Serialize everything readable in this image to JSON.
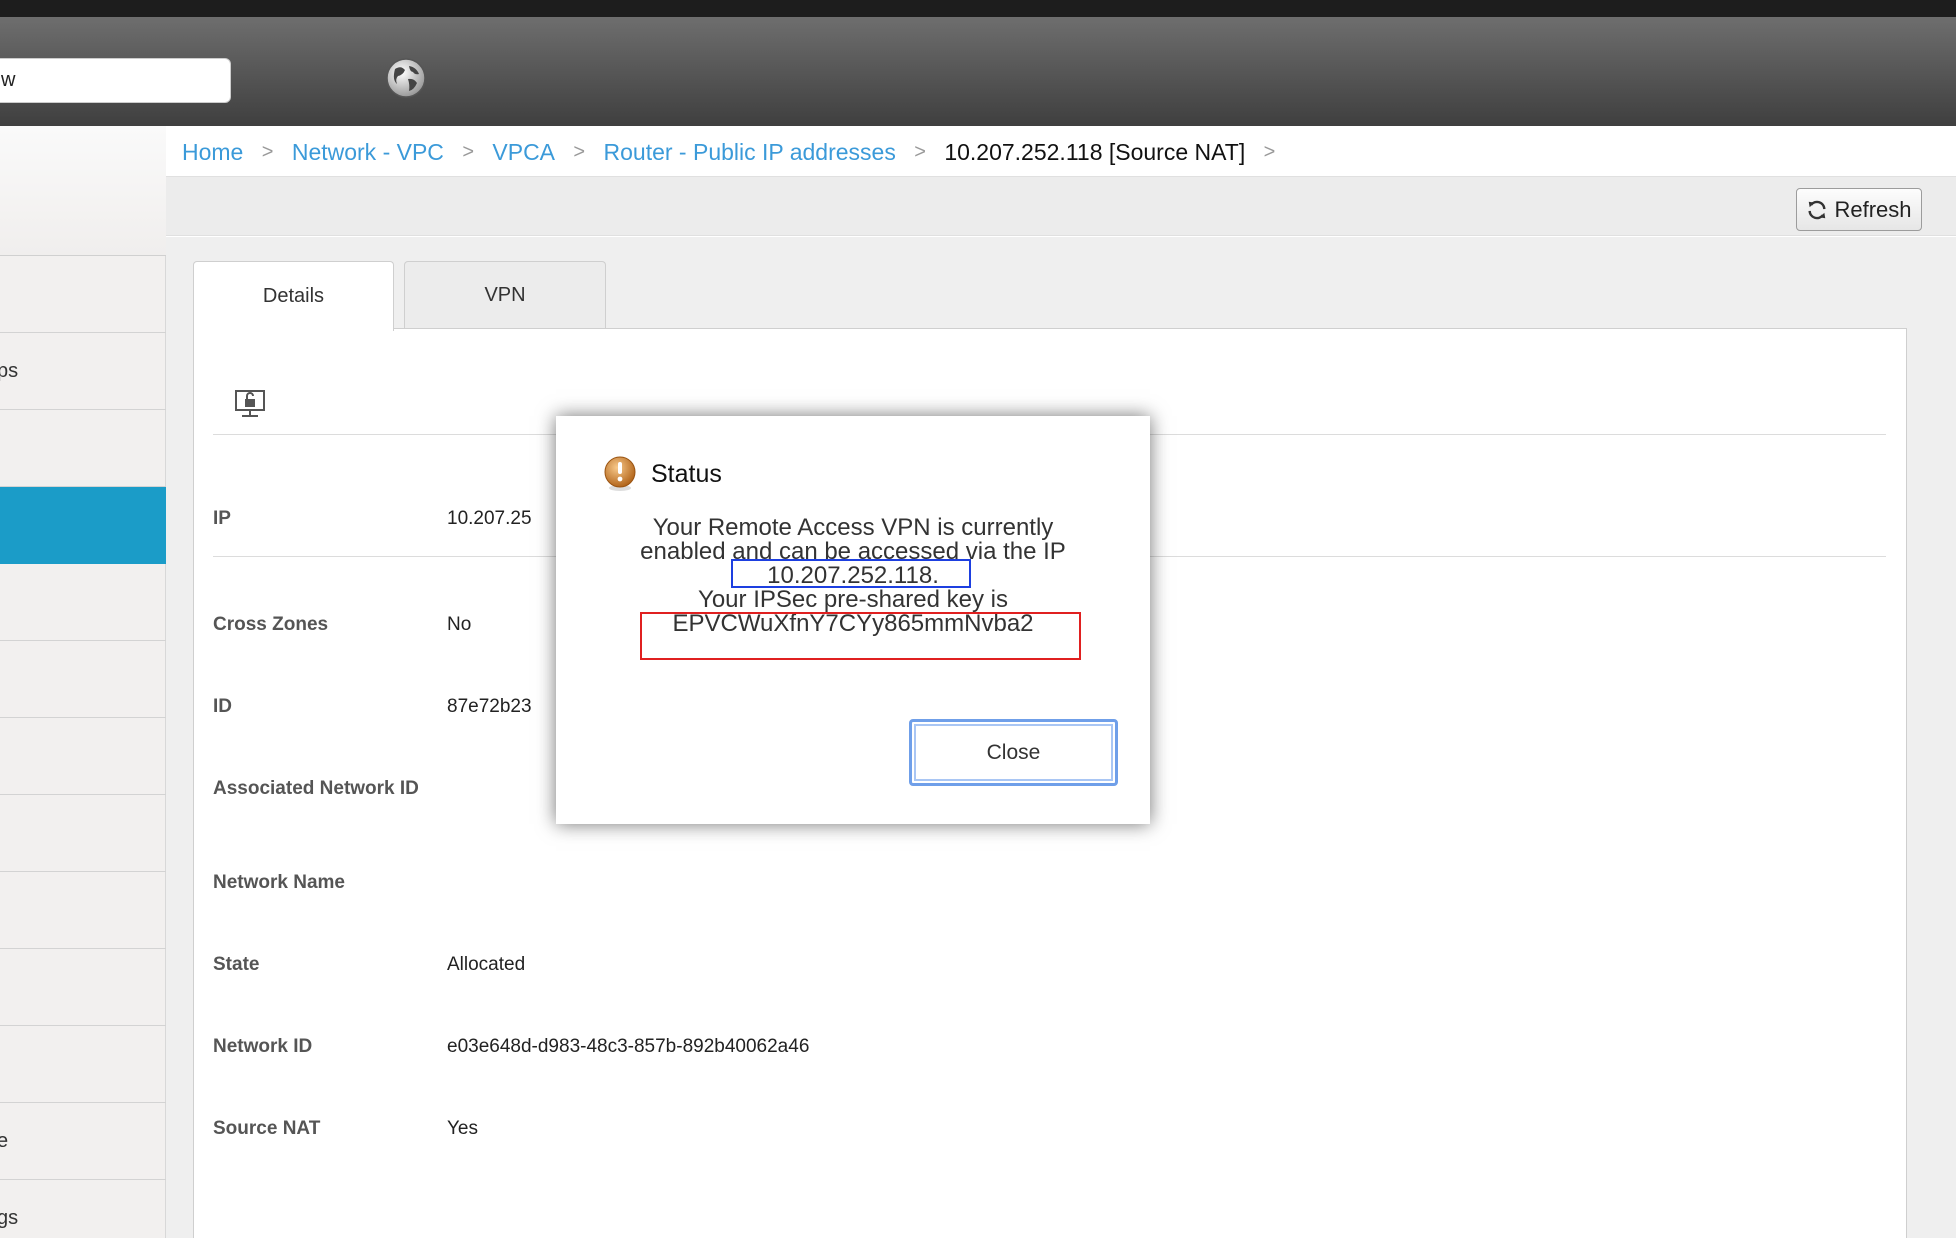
{
  "header": {
    "search_value": "w",
    "globe_icon": "globe-icon"
  },
  "sidebar": {
    "items": [
      {
        "label": ""
      },
      {
        "label": "ps"
      },
      {
        "label": ""
      },
      {
        "label": "",
        "active": true
      },
      {
        "label": ""
      },
      {
        "label": ""
      },
      {
        "label": ""
      },
      {
        "label": ""
      },
      {
        "label": ""
      },
      {
        "label": ""
      },
      {
        "label": ""
      },
      {
        "label": "e"
      },
      {
        "label": "gs"
      }
    ]
  },
  "breadcrumb": {
    "items": [
      "Home",
      "Network - VPC",
      "VPCA",
      "Router - Public IP addresses"
    ],
    "current": "10.207.252.118 [Source NAT]",
    "separator": ">"
  },
  "toolbar": {
    "refresh_label": "Refresh"
  },
  "tabs": {
    "details": "Details",
    "vpn": "VPN"
  },
  "details": {
    "rows": [
      {
        "label": "IP",
        "value": "10.207.25"
      },
      {
        "label": "Cross Zones",
        "value": "No"
      },
      {
        "label": "ID",
        "value": "87e72b23"
      },
      {
        "label": "Associated Network ID",
        "value": ""
      },
      {
        "label": "Network Name",
        "value": ""
      },
      {
        "label": "State",
        "value": "Allocated"
      },
      {
        "label": "Network ID",
        "value": "e03e648d-d983-48c3-857b-892b40062a46"
      },
      {
        "label": "Source NAT",
        "value": "Yes"
      }
    ]
  },
  "dialog": {
    "title": "Status",
    "line1": "Your Remote Access VPN is currently",
    "line2": "enabled and can be accessed via the IP",
    "ip": "10.207.252.118.",
    "line4": "Your IPSec pre-shared key is",
    "key": "EPVCWuXfnY7CYy865mmNvba2",
    "close_label": "Close"
  },
  "colors": {
    "link": "#3b9ad9",
    "active_sidebar": "#1b9cc8",
    "ip_highlight": "#1d3fe0",
    "key_highlight": "#e02020"
  }
}
